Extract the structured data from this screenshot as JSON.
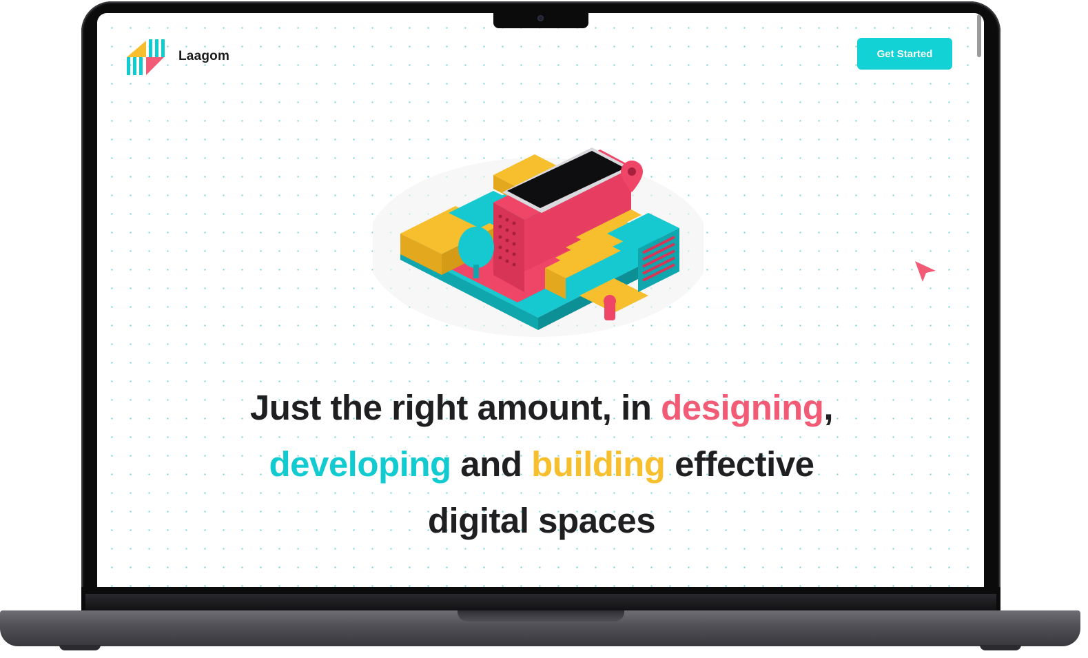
{
  "brand": {
    "name": "Laagom"
  },
  "header": {
    "cta_label": "Get Started"
  },
  "hero": {
    "line1_a": "Just the right amount, in ",
    "line1_b": "designing",
    "line1_c": ",",
    "line2_a": "developing",
    "line2_b": " and ",
    "line2_c": "building",
    "line2_d": " effective",
    "line3": "digital spaces"
  },
  "colors": {
    "accent_cyan": "#12d2d6",
    "accent_pink": "#f25b75",
    "accent_yellow": "#f7bf2d",
    "text_dark": "#1f1f22"
  },
  "icons": {
    "logo": "laagom-logo-icon",
    "cursor": "pointer-cursor-icon",
    "illustration": "isometric-city-phone-illustration"
  }
}
